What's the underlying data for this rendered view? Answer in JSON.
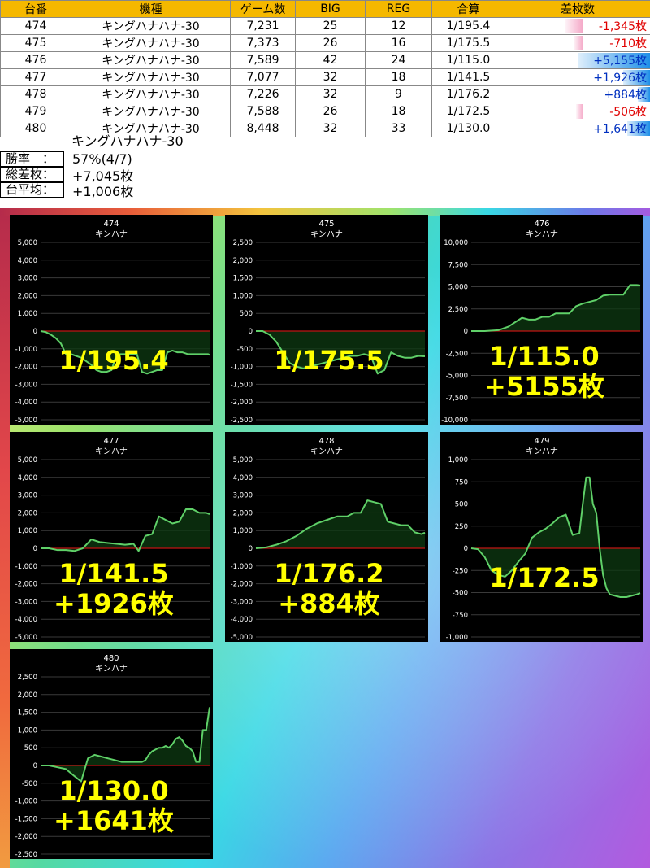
{
  "table": {
    "headers": [
      "台番",
      "機種",
      "ゲーム数",
      "BIG",
      "REG",
      "合算",
      "差枚数"
    ],
    "rows": [
      {
        "num": "474",
        "model": "キングハナハナ-30",
        "games": "7,231",
        "big": "25",
        "reg": "12",
        "rate": "1/195.4",
        "diff": "-1,345枚",
        "diff_value": -1345
      },
      {
        "num": "475",
        "model": "キングハナハナ-30",
        "games": "7,373",
        "big": "26",
        "reg": "16",
        "rate": "1/175.5",
        "diff": "-710枚",
        "diff_value": -710
      },
      {
        "num": "476",
        "model": "キングハナハナ-30",
        "games": "7,589",
        "big": "42",
        "reg": "24",
        "rate": "1/115.0",
        "diff": "+5,155枚",
        "diff_value": 5155
      },
      {
        "num": "477",
        "model": "キングハナハナ-30",
        "games": "7,077",
        "big": "32",
        "reg": "18",
        "rate": "1/141.5",
        "diff": "+1,926枚",
        "diff_value": 1926
      },
      {
        "num": "478",
        "model": "キングハナハナ-30",
        "games": "7,226",
        "big": "32",
        "reg": "9",
        "rate": "1/176.2",
        "diff": "+884枚",
        "diff_value": 884
      },
      {
        "num": "479",
        "model": "キングハナハナ-30",
        "games": "7,588",
        "big": "26",
        "reg": "18",
        "rate": "1/172.5",
        "diff": "-506枚",
        "diff_value": -506
      },
      {
        "num": "480",
        "model": "キングハナハナ-30",
        "games": "8,448",
        "big": "32",
        "reg": "33",
        "rate": "1/130.0",
        "diff": "+1,641枚",
        "diff_value": 1641
      }
    ]
  },
  "summary": {
    "model": "キングハナハナ-30",
    "win_label": "勝率",
    "win_value": "57%(4/7)",
    "total_label": "総差枚",
    "total_value": "+7,045枚",
    "avg_label": "台平均",
    "avg_value": "+1,006枚",
    "colon": "："
  },
  "colors": {
    "header": "#f5b800",
    "positive_bar": "#1e8fe8",
    "negative_bar": "#f4a6c6",
    "negative_text": "#e00000",
    "positive_text": "#0030c0",
    "line": "#5fd068",
    "zero_line": "#c01414",
    "overlay_text": "#ffff00"
  },
  "chart_data": [
    {
      "type": "line",
      "title": "474",
      "subtitle": "キンハナ",
      "ylim": [
        -5000,
        5000
      ],
      "yticks": [
        "5,000",
        "4,000",
        "3,000",
        "2,000",
        "1,000",
        "0",
        "-1,000",
        "-2,000",
        "-3,000",
        "-4,000",
        "-5,000"
      ],
      "overlay": [
        "1/195.4"
      ],
      "x": [
        0,
        3,
        6,
        9,
        12,
        15,
        18,
        21,
        24,
        27,
        30,
        33,
        36,
        39,
        42,
        45,
        48,
        51,
        54,
        57,
        60,
        63,
        66,
        69,
        72,
        75,
        78,
        81,
        84,
        87,
        90,
        93,
        96,
        99,
        100
      ],
      "values": [
        0,
        -50,
        -200,
        -400,
        -700,
        -1300,
        -1300,
        -1400,
        -1500,
        -1700,
        -1900,
        -2200,
        -2300,
        -2300,
        -2200,
        -1300,
        -1300,
        -1300,
        -1300,
        -1300,
        -2300,
        -2400,
        -2300,
        -2200,
        -2200,
        -1200,
        -1100,
        -1200,
        -1200,
        -1300,
        -1300,
        -1300,
        -1300,
        -1300,
        -1345
      ]
    },
    {
      "type": "line",
      "title": "475",
      "subtitle": "キンハナ",
      "ylim": [
        -2500,
        2500
      ],
      "yticks": [
        "2,500",
        "2,000",
        "1,500",
        "1,000",
        "500",
        "0",
        "-500",
        "-1,000",
        "-1,500",
        "-2,000",
        "-2,500"
      ],
      "overlay": [
        "1/175.5"
      ],
      "x": [
        0,
        4,
        8,
        12,
        16,
        20,
        24,
        28,
        32,
        36,
        40,
        44,
        48,
        52,
        56,
        60,
        64,
        68,
        72,
        76,
        80,
        84,
        88,
        92,
        96,
        100
      ],
      "values": [
        0,
        0,
        -100,
        -300,
        -600,
        -900,
        -1000,
        -1050,
        -1000,
        -950,
        -900,
        -850,
        -800,
        -750,
        -700,
        -700,
        -650,
        -700,
        -1200,
        -1100,
        -600,
        -700,
        -750,
        -750,
        -700,
        -710
      ]
    },
    {
      "type": "line",
      "title": "476",
      "subtitle": "キンハナ",
      "ylim": [
        -10000,
        10000
      ],
      "yticks": [
        "10,000",
        "7,500",
        "5,000",
        "2,500",
        "0",
        "-2,500",
        "-5,000",
        "-7,500",
        "-10,000"
      ],
      "overlay": [
        "1/115.0",
        "+5155枚"
      ],
      "x": [
        0,
        8,
        16,
        22,
        26,
        30,
        34,
        38,
        42,
        46,
        50,
        54,
        58,
        62,
        66,
        70,
        74,
        78,
        82,
        86,
        90,
        94,
        98,
        100
      ],
      "values": [
        0,
        0,
        100,
        500,
        1000,
        1500,
        1300,
        1300,
        1600,
        1600,
        2000,
        2000,
        2000,
        2800,
        3100,
        3300,
        3500,
        4000,
        4100,
        4100,
        4100,
        5200,
        5200,
        5155
      ]
    },
    {
      "type": "line",
      "title": "477",
      "subtitle": "キンハナ",
      "ylim": [
        -5000,
        5000
      ],
      "yticks": [
        "5,000",
        "4,000",
        "3,000",
        "2,000",
        "1,000",
        "0",
        "-1,000",
        "-2,000",
        "-3,000",
        "-4,000",
        "-5,000"
      ],
      "overlay": [
        "1/141.5",
        "+1926枚"
      ],
      "x": [
        0,
        5,
        10,
        15,
        20,
        25,
        30,
        35,
        40,
        45,
        50,
        55,
        58,
        62,
        66,
        70,
        74,
        78,
        82,
        86,
        90,
        94,
        98,
        100
      ],
      "values": [
        0,
        0,
        -100,
        -100,
        -150,
        0,
        500,
        350,
        300,
        250,
        200,
        250,
        -150,
        700,
        800,
        1800,
        1600,
        1400,
        1500,
        2200,
        2200,
        2000,
        2000,
        1926
      ]
    },
    {
      "type": "line",
      "title": "478",
      "subtitle": "キンハナ",
      "ylim": [
        -5000,
        5000
      ],
      "yticks": [
        "5,000",
        "4,000",
        "3,000",
        "2,000",
        "1,000",
        "0",
        "-1,000",
        "-2,000",
        "-3,000",
        "-4,000",
        "-5,000"
      ],
      "overlay": [
        "1/176.2",
        "+884枚"
      ],
      "x": [
        0,
        6,
        12,
        18,
        24,
        30,
        36,
        42,
        48,
        54,
        58,
        62,
        66,
        70,
        74,
        78,
        82,
        86,
        90,
        94,
        98,
        100
      ],
      "values": [
        0,
        50,
        200,
        400,
        700,
        1100,
        1400,
        1600,
        1800,
        1800,
        2000,
        2000,
        2700,
        2600,
        2500,
        1500,
        1400,
        1300,
        1300,
        900,
        800,
        884
      ]
    },
    {
      "type": "line",
      "title": "479",
      "subtitle": "キンハナ",
      "ylim": [
        -1000,
        1000
      ],
      "yticks": [
        "1,000",
        "750",
        "500",
        "250",
        "0",
        "-250",
        "-500",
        "-750",
        "-1,000"
      ],
      "overlay": [
        "1/172.5"
      ],
      "x": [
        0,
        4,
        8,
        12,
        16,
        20,
        24,
        28,
        32,
        36,
        40,
        44,
        48,
        52,
        56,
        60,
        64,
        66,
        68,
        70,
        72,
        74,
        76,
        78,
        80,
        82,
        84,
        86,
        88,
        90,
        92,
        94,
        96,
        98,
        100
      ],
      "values": [
        0,
        -10,
        -100,
        -250,
        -300,
        -320,
        -250,
        -150,
        -60,
        120,
        180,
        220,
        280,
        350,
        380,
        150,
        170,
        500,
        800,
        800,
        500,
        400,
        0,
        -300,
        -450,
        -520,
        -530,
        -540,
        -550,
        -550,
        -550,
        -540,
        -530,
        -520,
        -506
      ]
    },
    {
      "type": "line",
      "title": "480",
      "subtitle": "キンハナ",
      "ylim": [
        -2500,
        2500
      ],
      "yticks": [
        "2,500",
        "2,000",
        "1,500",
        "1,000",
        "500",
        "0",
        "-500",
        "-1,000",
        "-1,500",
        "-2,000",
        "-2,500"
      ],
      "overlay": [
        "1/130.0",
        "+1641枚"
      ],
      "x": [
        0,
        5,
        10,
        15,
        20,
        24,
        28,
        32,
        36,
        40,
        44,
        48,
        52,
        56,
        60,
        62,
        64,
        66,
        68,
        70,
        72,
        74,
        76,
        78,
        80,
        82,
        84,
        86,
        88,
        90,
        92,
        94,
        96,
        98,
        100
      ],
      "values": [
        0,
        0,
        -50,
        -100,
        -300,
        -450,
        200,
        300,
        250,
        200,
        150,
        100,
        100,
        100,
        100,
        150,
        300,
        400,
        450,
        500,
        500,
        550,
        500,
        600,
        750,
        800,
        700,
        550,
        500,
        400,
        100,
        100,
        1000,
        1000,
        1641
      ]
    }
  ]
}
